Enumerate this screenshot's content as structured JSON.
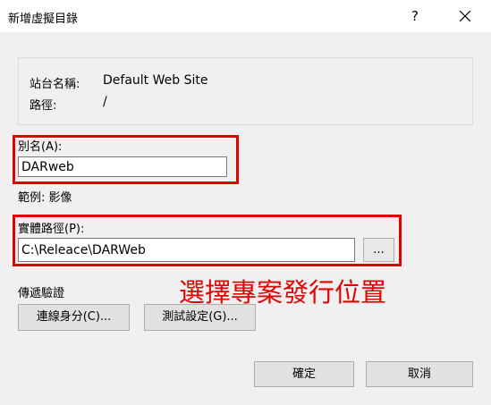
{
  "window": {
    "title": "新增虛擬目錄",
    "help_label": "?"
  },
  "info": {
    "site_label": "站台名稱:",
    "site_value": "Default Web Site",
    "path_label": "路徑:",
    "path_value": "/"
  },
  "alias": {
    "label": "別名(A):",
    "value": "DARweb",
    "example": "範例: 影像"
  },
  "physical_path": {
    "label": "實體路徑(P):",
    "value": "C:\\Releace\\DARWeb",
    "browse_label": "..."
  },
  "auth": {
    "label": "傳遞驗證",
    "connect_as_label": "連線身分(C)...",
    "test_settings_label": "測試設定(G)..."
  },
  "annotation": {
    "text": "選擇專案發行位置",
    "color": "#e00000"
  },
  "footer": {
    "ok_label": "確定",
    "cancel_label": "取消"
  }
}
